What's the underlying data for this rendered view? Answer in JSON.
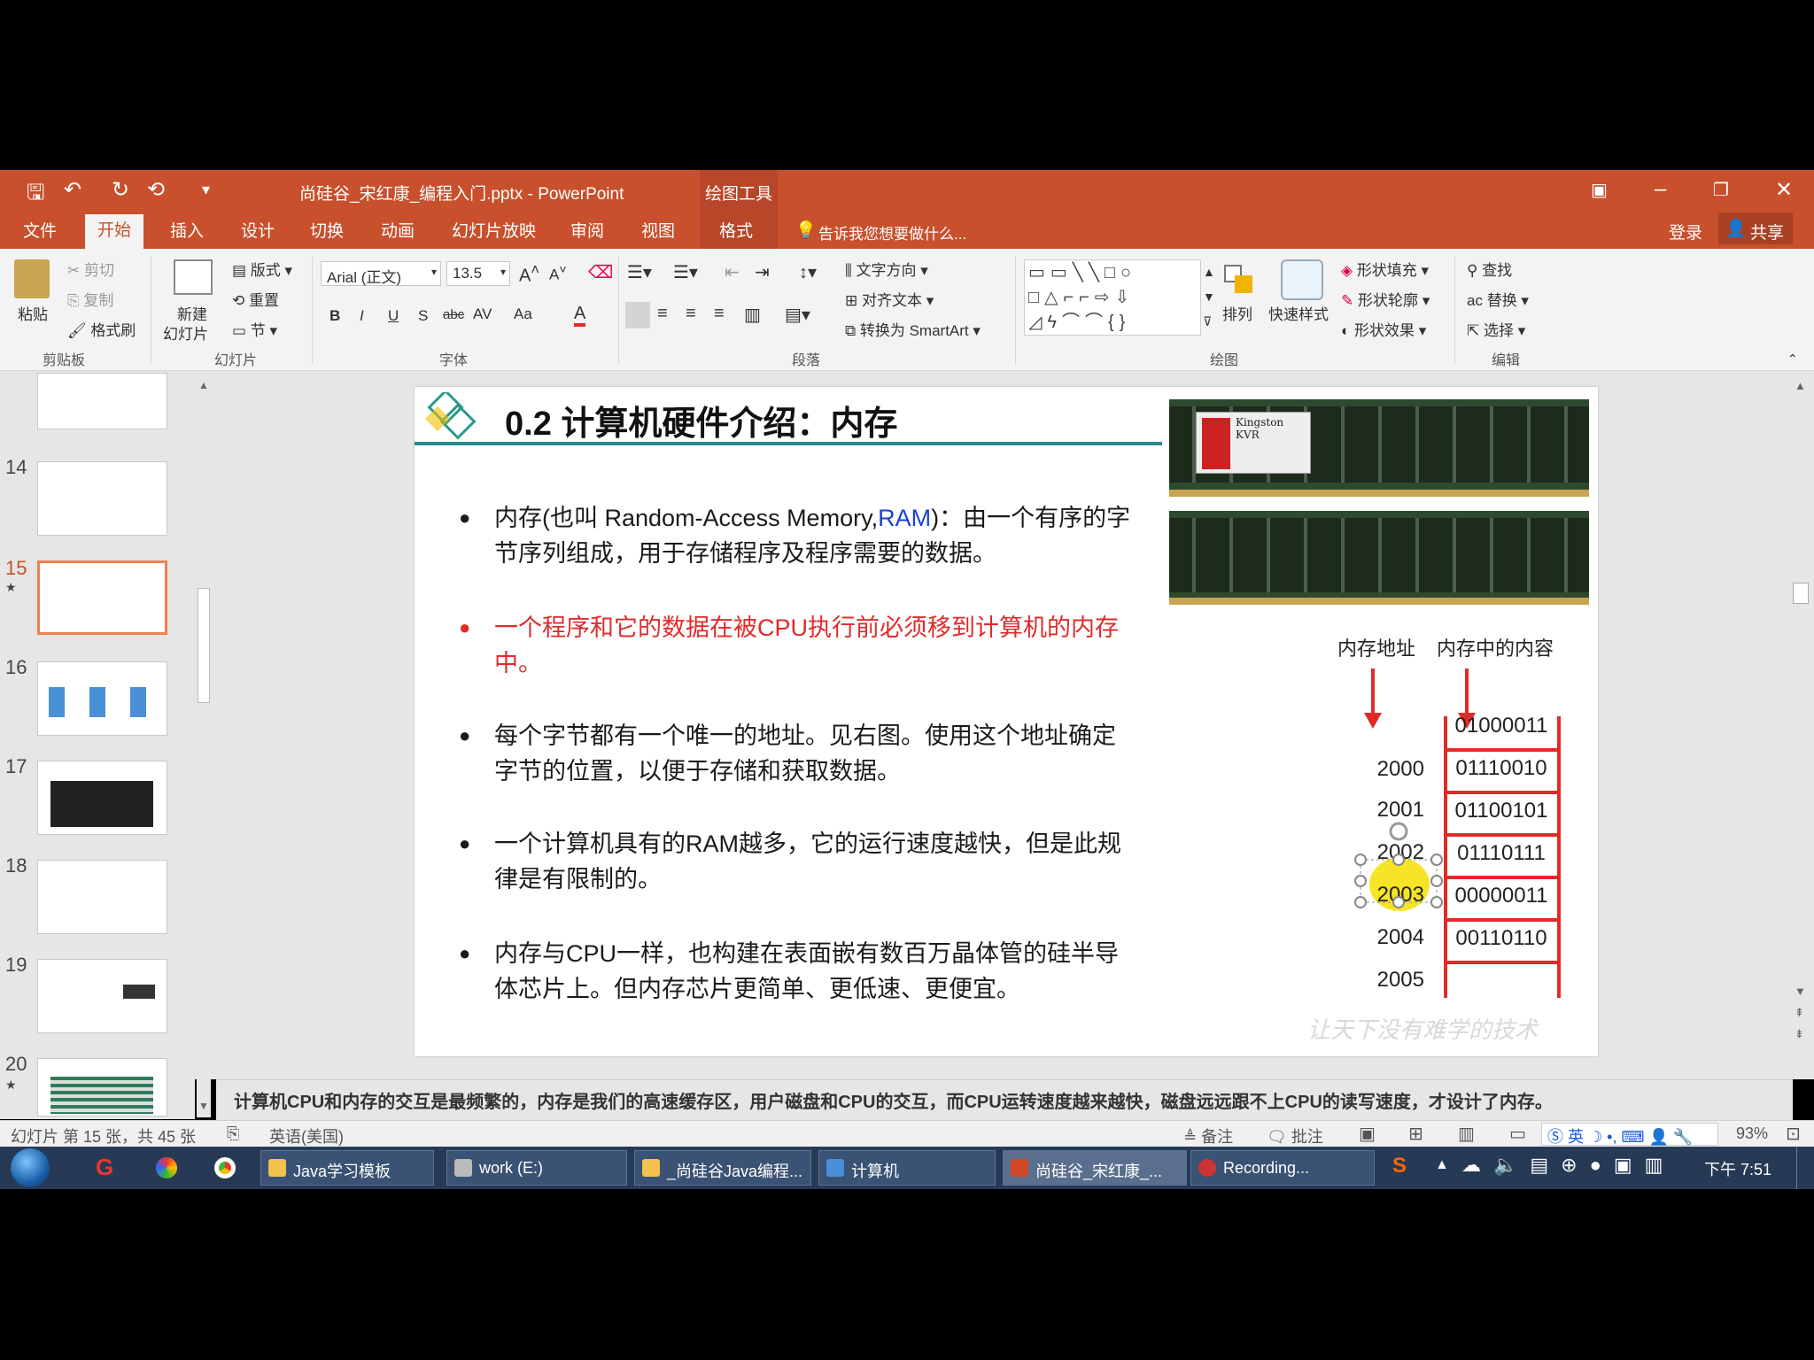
{
  "titlebar": {
    "doc_title": "尚硅谷_宋红康_编程入门.pptx - PowerPoint",
    "context_tab": "绘图工具"
  },
  "tabs": [
    "文件",
    "开始",
    "插入",
    "设计",
    "切换",
    "动画",
    "幻灯片放映",
    "审阅",
    "视图",
    "格式"
  ],
  "tell_me": "告诉我您想要做什么...",
  "account": {
    "login": "登录",
    "share": "共享"
  },
  "ribbon": {
    "clipboard": {
      "paste": "粘贴",
      "cut": "剪切",
      "copy": "复制",
      "format_painter": "格式刷",
      "group": "剪贴板"
    },
    "slides": {
      "new_slide_line1": "新建",
      "new_slide_line2": "幻灯片",
      "layout": "版式",
      "reset": "重置",
      "section": "节",
      "group": "幻灯片"
    },
    "font": {
      "family": "Arial (正文)",
      "size": "13.5",
      "bold": "B",
      "italic": "I",
      "underline": "U",
      "shadow": "S",
      "strike": "abc",
      "spacing": "AV",
      "case": "Aa",
      "color": "A",
      "group": "字体"
    },
    "paragraph": {
      "text_direction": "文字方向",
      "align_text": "对齐文本",
      "smartart": "转换为 SmartArt",
      "group": "段落"
    },
    "drawing": {
      "arrange": "排列",
      "quick_styles": "快速样式",
      "shape_fill": "形状填充",
      "shape_outline": "形状轮廓",
      "shape_effects": "形状效果",
      "group": "绘图"
    },
    "editing": {
      "find": "查找",
      "replace": "替换",
      "select": "选择",
      "group": "编辑"
    }
  },
  "thumbnails": [
    {
      "num": "14",
      "star": ""
    },
    {
      "num": "15",
      "star": "★"
    },
    {
      "num": "16",
      "star": ""
    },
    {
      "num": "17",
      "star": ""
    },
    {
      "num": "18",
      "star": ""
    },
    {
      "num": "19",
      "star": ""
    },
    {
      "num": "20",
      "star": "★"
    }
  ],
  "slide": {
    "title": "0.2 计算机硬件介绍：内存",
    "bullets": [
      {
        "pre": "内存(也叫 Random-Access Memory,",
        "highlight": "RAM",
        "post": ")：由一个有序的字节序列组成，用于存储程序及程序需要的数据。"
      },
      {
        "text": "一个程序和它的数据在被CPU执行前必须移到计算机的内存中。"
      },
      {
        "text": "每个字节都有一个唯一的地址。见右图。使用这个地址确定字节的位置，以便于存储和获取数据。"
      },
      {
        "text": "一个计算机具有的RAM越多，它的运行速度越快，但是此规律是有限制的。"
      },
      {
        "text": "内存与CPU一样，也构建在表面嵌有数百万晶体管的硅半导体芯片上。但内存芯片更简单、更低速、更便宜。"
      }
    ],
    "ram_label": "Kingston KVR",
    "header_address": "内存地址",
    "header_content": "内存中的内容",
    "addresses": [
      "2000",
      "2001",
      "2002",
      "2003",
      "2004",
      "2005"
    ],
    "contents": [
      "01000011",
      "01110010",
      "01100101",
      "01110111",
      "00000011",
      "00110110"
    ],
    "watermark": "让天下没有难学的技术"
  },
  "notes": "计算机CPU和内存的交互是最频繁的，内存是我们的高速缓存区，用户磁盘和CPU的交互，而CPU运转速度越来越快，磁盘远远跟不上CPU的读写速度，才设计了内存。",
  "status": {
    "slide_info": "幻灯片 第 15 张，共 45 张",
    "language": "英语(美国)",
    "notes_btn": "备注",
    "comments_btn": "批注",
    "zoom": "93%"
  },
  "taskbar": {
    "items": [
      "Java学习模板",
      "work (E:)",
      "_尚硅谷Java编程...",
      "计算机",
      "尚硅谷_宋红康_...",
      "Recording..."
    ],
    "ime": "英",
    "clock": "下午 7:51"
  },
  "colors": {
    "accent": "#c8502d",
    "slide_red": "#e12a2a",
    "ram_blue": "#1a3fd6",
    "title_line": "#2a8a85"
  }
}
